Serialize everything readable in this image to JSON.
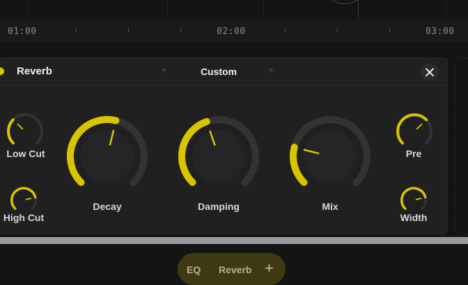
{
  "timeline": {
    "markers": [
      "01:00",
      "02:00",
      "03:00"
    ]
  },
  "plugin": {
    "name": "Reverb",
    "preset": "Custom",
    "preset_prev_icon": "chevron-left-icon",
    "preset_next_icon": "chevron-right-icon",
    "close_icon": "close-icon",
    "accent": "#d8c400"
  },
  "knobs": {
    "low_cut": {
      "label": "Low Cut",
      "value": 0.33
    },
    "high_cut": {
      "label": "High Cut",
      "value": 0.78
    },
    "decay": {
      "label": "Decay",
      "value": 0.55
    },
    "damping": {
      "label": "Damping",
      "value": 0.43
    },
    "mix": {
      "label": "Mix",
      "value": 0.22
    },
    "pre": {
      "label": "Pre",
      "value": 0.67
    },
    "width": {
      "label": "Width",
      "value": 0.78
    }
  },
  "fx_chain": {
    "items": [
      "EQ",
      "Reverb"
    ],
    "add_icon": "plus-icon"
  }
}
